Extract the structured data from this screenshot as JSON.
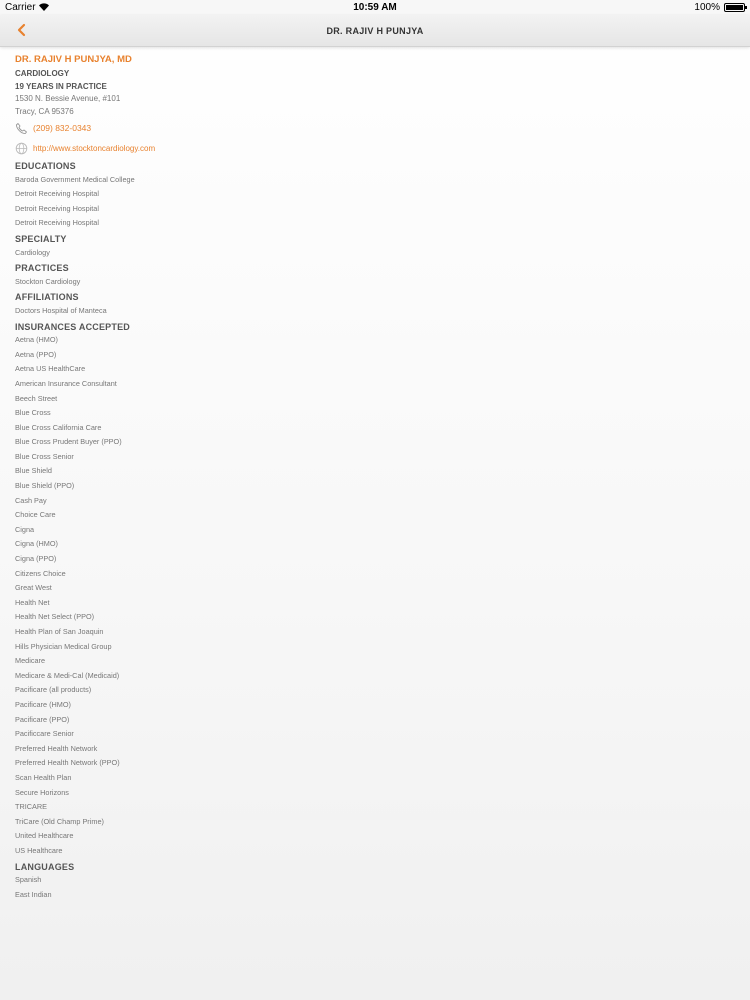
{
  "status_bar": {
    "carrier": "Carrier",
    "time": "10:59 AM",
    "battery": "100%"
  },
  "nav": {
    "title": "DR. RAJIV H PUNJYA"
  },
  "profile": {
    "name": "DR. RAJIV H PUNJYA, MD",
    "specialty": "CARDIOLOGY",
    "years": "19 YEARS IN PRACTICE",
    "address_line1": "1530 N. Bessie Avenue, #101",
    "address_line2": "Tracy, CA 95376",
    "phone": "(209) 832-0343",
    "website": "http://www.stocktoncardiology.com"
  },
  "sections": {
    "educations": {
      "heading": "EDUCATIONS",
      "items": [
        "Baroda Government Medical College",
        "Detroit Receiving Hospital",
        "Detroit Receiving Hospital",
        "Detroit Receiving Hospital"
      ]
    },
    "specialty": {
      "heading": "SPECIALTY",
      "items": [
        "Cardiology"
      ]
    },
    "practices": {
      "heading": "PRACTICES",
      "items": [
        "Stockton Cardiology"
      ]
    },
    "affiliations": {
      "heading": "AFFILIATIONS",
      "items": [
        "Doctors Hospital of Manteca"
      ]
    },
    "insurances": {
      "heading": "INSURANCES ACCEPTED",
      "items": [
        "Aetna (HMO)",
        "Aetna (PPO)",
        "Aetna US HealthCare",
        "American Insurance Consultant",
        "Beech Street",
        "Blue Cross",
        "Blue Cross California Care",
        "Blue Cross Prudent Buyer (PPO)",
        "Blue Cross Senior",
        "Blue Shield",
        "Blue Shield (PPO)",
        "Cash Pay",
        "Choice Care",
        "Cigna",
        "Cigna (HMO)",
        "Cigna (PPO)",
        "Citizens Choice",
        "Great West",
        "Health Net",
        "Health Net Select (PPO)",
        "Health Plan of San Joaquin",
        "Hills Physician Medical Group",
        "Medicare",
        "Medicare & Medi-Cal (Medicaid)",
        "Pacificare (all products)",
        "Pacificare (HMO)",
        "Pacificare (PPO)",
        "Pacificcare Senior",
        "Preferred Health Network",
        "Preferred Health Network (PPO)",
        "Scan Health Plan",
        "Secure Horizons",
        "TRICARE",
        "TriCare (Old Champ Prime)",
        "United Healthcare",
        "US Healthcare"
      ]
    },
    "languages": {
      "heading": "LANGUAGES",
      "items": [
        "Spanish",
        "East Indian"
      ]
    }
  },
  "colors": {
    "accent": "#e8822f",
    "heading": "#555555",
    "body": "#777777"
  }
}
